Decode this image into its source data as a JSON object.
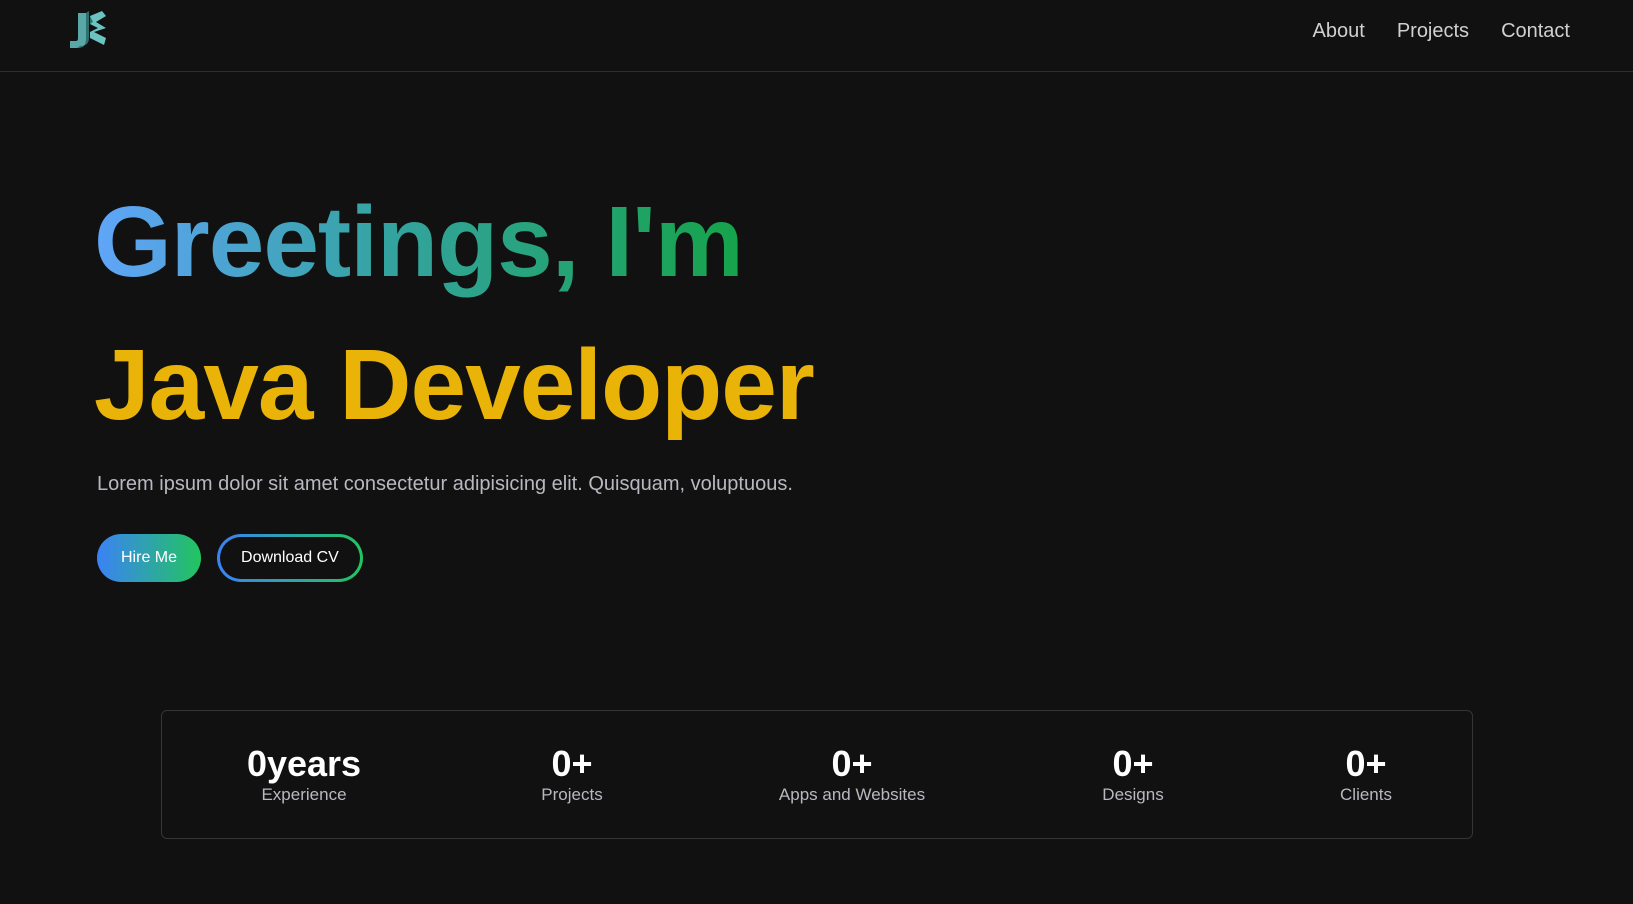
{
  "nav": {
    "logo_text": "JK",
    "links": [
      "About",
      "Projects",
      "Contact"
    ]
  },
  "hero": {
    "greeting": "Greetings, I'm",
    "role": "Java Developer",
    "description": "Lorem ipsum dolor sit amet consectetur adipisicing elit. Quisquam, voluptuous.",
    "hire_label": "Hire Me",
    "cv_label": "Download CV"
  },
  "stats": [
    {
      "value": "0years",
      "label": "Experience"
    },
    {
      "value": "0+",
      "label": "Projects"
    },
    {
      "value": "0+",
      "label": "Apps and Websites"
    },
    {
      "value": "0+",
      "label": "Designs"
    },
    {
      "value": "0+",
      "label": "Clients"
    }
  ],
  "colors": {
    "background": "#111111",
    "accent_yellow": "#eab308",
    "gradient_start": "#60a5fa",
    "gradient_end": "#16a34a"
  }
}
